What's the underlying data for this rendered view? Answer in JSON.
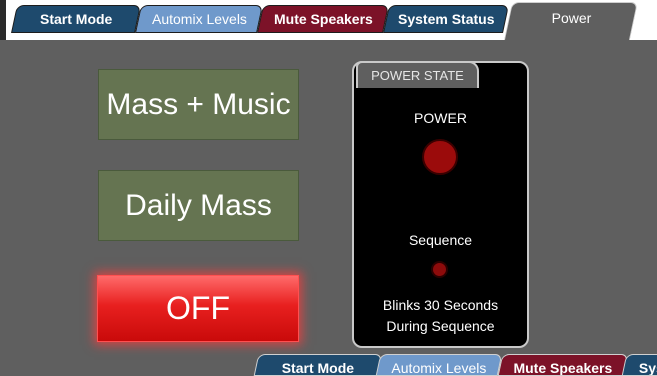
{
  "top_tabs": [
    {
      "label": "Start Mode"
    },
    {
      "label": "Automix Levels"
    },
    {
      "label": "Mute Speakers"
    },
    {
      "label": "System Status"
    },
    {
      "label": "Power"
    }
  ],
  "mode_buttons": {
    "mass_music": "Mass + Music",
    "daily_mass": "Daily Mass",
    "off": "OFF"
  },
  "power_panel": {
    "title": "POWER STATE",
    "power_label": "POWER",
    "sequence_label": "Sequence",
    "note_line1": "Blinks 30 Seconds",
    "note_line2": "During Sequence"
  },
  "bottom_tabs": [
    {
      "label": "Start Mode"
    },
    {
      "label": "Automix Levels"
    },
    {
      "label": "Mute Speakers"
    },
    {
      "label": "Sys"
    }
  ],
  "colors": {
    "background": "#5f5f5f",
    "tab_dark_blue": "#1e4a6d",
    "tab_light_blue": "#6f99cb",
    "tab_maroon": "#7c1228",
    "mode_button_green": "#657451",
    "off_red": "#e8201f",
    "led_red": "#9b0b0b"
  }
}
